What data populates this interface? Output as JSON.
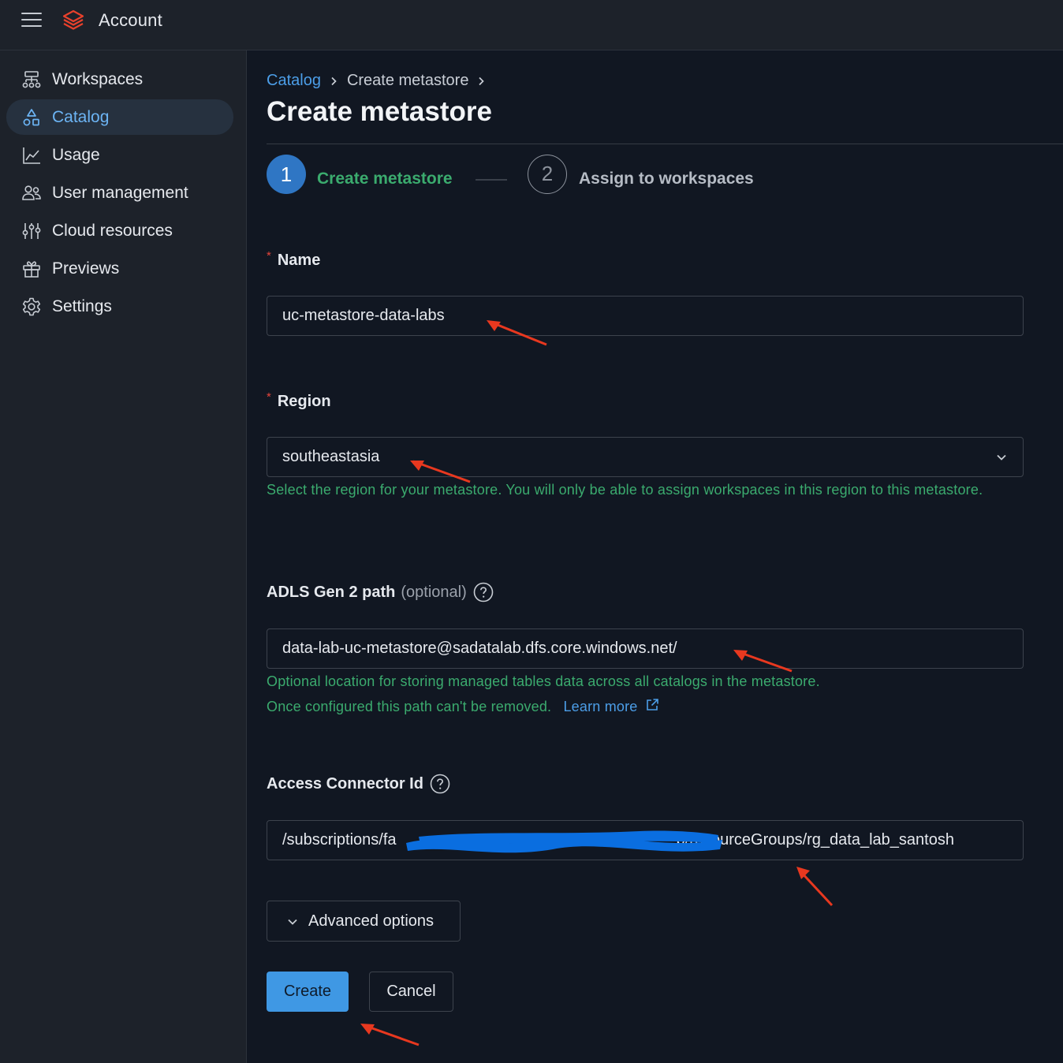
{
  "app": {
    "title": "Account"
  },
  "sidebar": {
    "items": [
      {
        "label": "Workspaces",
        "icon": "workspaces-icon",
        "active": false
      },
      {
        "label": "Catalog",
        "icon": "catalog-icon",
        "active": true
      },
      {
        "label": "Usage",
        "icon": "usage-chart-icon",
        "active": false
      },
      {
        "label": "User management",
        "icon": "users-icon",
        "active": false
      },
      {
        "label": "Cloud resources",
        "icon": "sliders-icon",
        "active": false
      },
      {
        "label": "Previews",
        "icon": "gift-icon",
        "active": false
      },
      {
        "label": "Settings",
        "icon": "gear-icon",
        "active": false
      }
    ]
  },
  "breadcrumb": {
    "items": [
      "Catalog",
      "Create metastore"
    ]
  },
  "page": {
    "title": "Create metastore"
  },
  "stepper": {
    "steps": [
      {
        "number": "1",
        "label": "Create metastore",
        "state": "active"
      },
      {
        "number": "2",
        "label": "Assign to workspaces",
        "state": "pending"
      }
    ]
  },
  "form": {
    "name": {
      "required_mark": "*",
      "label": "Name",
      "value": "uc-metastore-data-labs"
    },
    "region": {
      "required_mark": "*",
      "label": "Region",
      "value": "southeastasia",
      "hint": "Select the region for your metastore. You will only be able to assign workspaces in this region to this metastore."
    },
    "adls": {
      "label": "ADLS Gen 2 path",
      "optional": "(optional)",
      "value": "data-lab-uc-metastore@sadatalab.dfs.core.windows.net/",
      "hint_line1": "Optional location for storing managed tables data across all catalogs in the metastore.",
      "hint_line2": "Once configured this path can't be removed.",
      "learn_more": "Learn more"
    },
    "connector": {
      "label": "Access Connector Id",
      "value_prefix": "/subscriptions/fa",
      "value_suffix": "b/resourceGroups/rg_data_lab_santosh"
    }
  },
  "buttons": {
    "advanced": "Advanced options",
    "create": "Create",
    "cancel": "Cancel"
  },
  "colors": {
    "accent": "#3f98e4",
    "link": "#4c9ee8",
    "success": "#3bab6e",
    "required": "#e5453b",
    "annotation_arrow": "#e8381f",
    "redaction": "#0a6ee0"
  }
}
